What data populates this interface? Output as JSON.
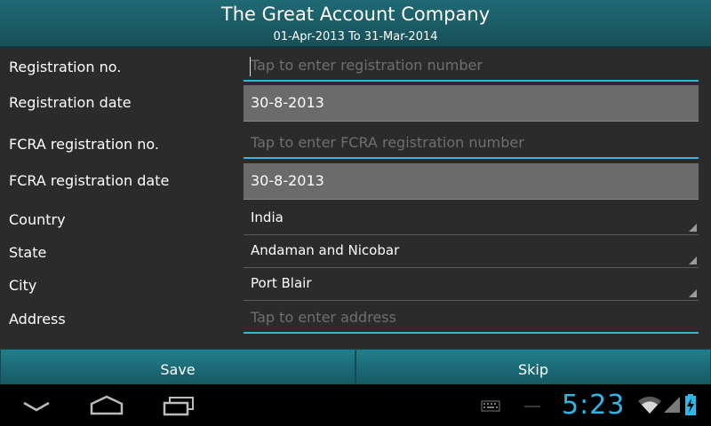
{
  "header": {
    "title": "The Great Account Company",
    "period": "01-Apr-2013 To 31-Mar-2014"
  },
  "form": {
    "registration_no": {
      "label": "Registration no.",
      "placeholder": "Tap to enter registration number"
    },
    "registration_date": {
      "label": "Registration date",
      "value": "30-8-2013"
    },
    "fcra_no": {
      "label": "FCRA registration no.",
      "placeholder": "Tap to enter FCRA registration number"
    },
    "fcra_date": {
      "label": "FCRA registration date",
      "value": "30-8-2013"
    },
    "country": {
      "label": "Country",
      "value": "India"
    },
    "state": {
      "label": "State",
      "value": "Andaman and Nicobar"
    },
    "city": {
      "label": "City",
      "value": "Port Blair"
    },
    "address": {
      "label": "Address",
      "placeholder": "Tap to enter address"
    }
  },
  "actions": {
    "save_label": "Save",
    "skip_label": "Skip"
  },
  "status": {
    "time": "5:23",
    "accent_color": "#33b5e5",
    "icons": [
      "back-icon",
      "home-icon",
      "recent-apps-icon",
      "keyboard-icon",
      "wifi-icon",
      "signal-icon",
      "battery-charging-icon"
    ]
  }
}
